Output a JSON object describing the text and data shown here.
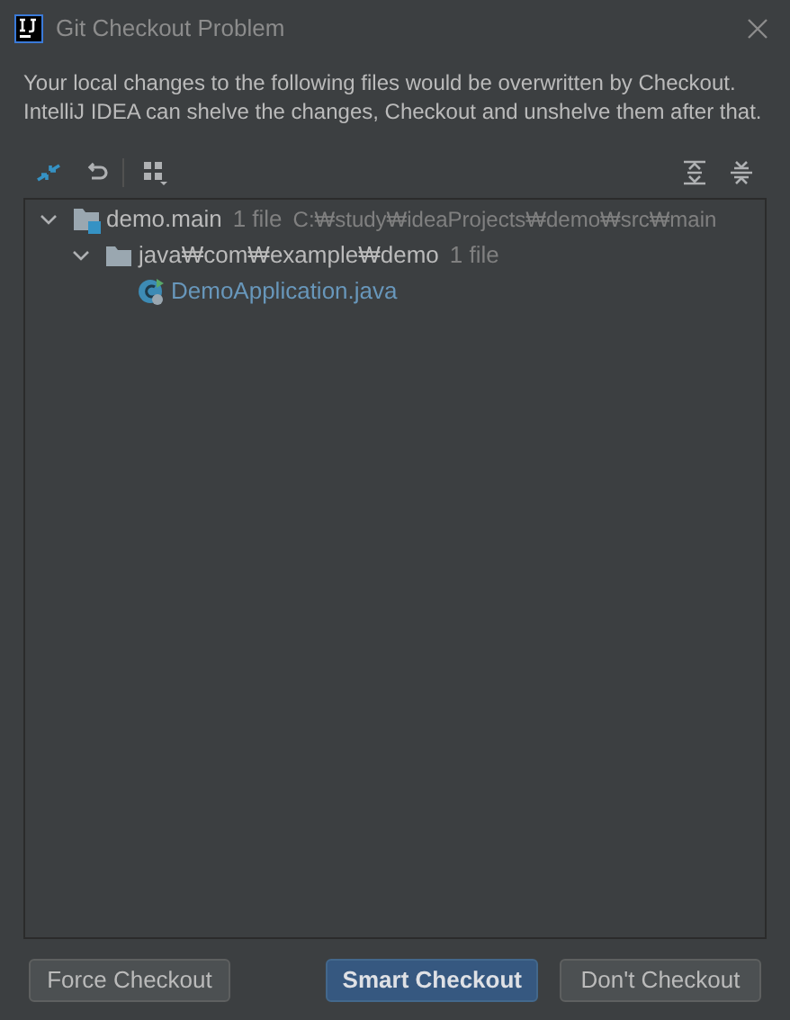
{
  "window": {
    "title": "Git Checkout Problem"
  },
  "message": [
    "Your local changes to the following files would be overwritten by Checkout.",
    "IntelliJ IDEA can shelve the changes, Checkout and unshelve them after that."
  ],
  "tree": [
    {
      "kind": "module",
      "name": "demo.main",
      "count": "1 file",
      "path": "C:₩study₩ideaProjects₩demo₩src₩main",
      "expanded": true,
      "children": [
        {
          "kind": "folder",
          "name": "java₩com₩example₩demo",
          "count": "1 file",
          "expanded": true,
          "children": [
            {
              "kind": "file",
              "name": "DemoApplication.java"
            }
          ]
        }
      ]
    }
  ],
  "buttons": [
    {
      "label": "Force Checkout",
      "kind": "default"
    },
    {
      "label": "Smart Checkout",
      "kind": "primary"
    },
    {
      "label": "Don't Checkout",
      "kind": "default"
    }
  ]
}
